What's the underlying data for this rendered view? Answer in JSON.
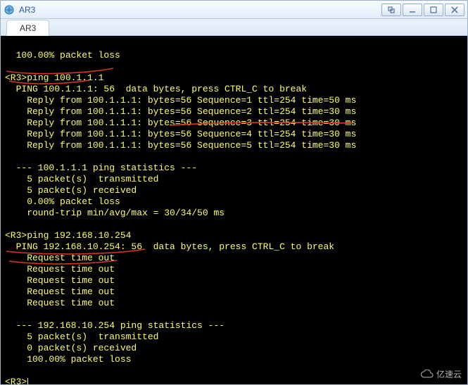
{
  "window": {
    "title": "AR3"
  },
  "tabs": [
    {
      "label": "AR3"
    }
  ],
  "prompt": {
    "open": "<R3>",
    "close": "<R3>"
  },
  "commands": {
    "ping1": "ping 100.1.1.1",
    "ping2": "ping 192.168.10.254"
  },
  "output": {
    "prev_loss": "  100.00% packet loss",
    "blank": "",
    "ping1_header": "  PING 100.1.1.1: 56  data bytes, press CTRL_C to break",
    "ping1_replies": [
      "    Reply from 100.1.1.1: bytes=56 Sequence=1 ttl=254 time=50 ms",
      "    Reply from 100.1.1.1: bytes=56 Sequence=2 ttl=254 time=30 ms",
      "    Reply from 100.1.1.1: bytes=56 Sequence=3 ttl=254 time=30 ms",
      "    Reply from 100.1.1.1: bytes=56 Sequence=4 ttl=254 time=30 ms",
      "    Reply from 100.1.1.1: bytes=56 Sequence=5 ttl=254 time=30 ms"
    ],
    "ping1_stats_hdr": "  --- 100.1.1.1 ping statistics ---",
    "ping1_stats": [
      "    5 packet(s)  transmitted",
      "    5 packet(s) received",
      "    0.00% packet loss",
      "    round-trip min/avg/max = 30/34/50 ms"
    ],
    "ping2_header": "  PING 192.168.10.254: 56  data bytes, press CTRL_C to break",
    "ping2_replies": [
      "    Request time out",
      "    Request time out",
      "    Request time out",
      "    Request time out",
      "    Request time out"
    ],
    "ping2_stats_hdr": "  --- 192.168.10.254 ping statistics ---",
    "ping2_stats": [
      "    5 packet(s)  transmitted",
      "    0 packet(s) received",
      "    100.00% packet loss"
    ]
  },
  "watermark": {
    "text": "亿速云"
  }
}
